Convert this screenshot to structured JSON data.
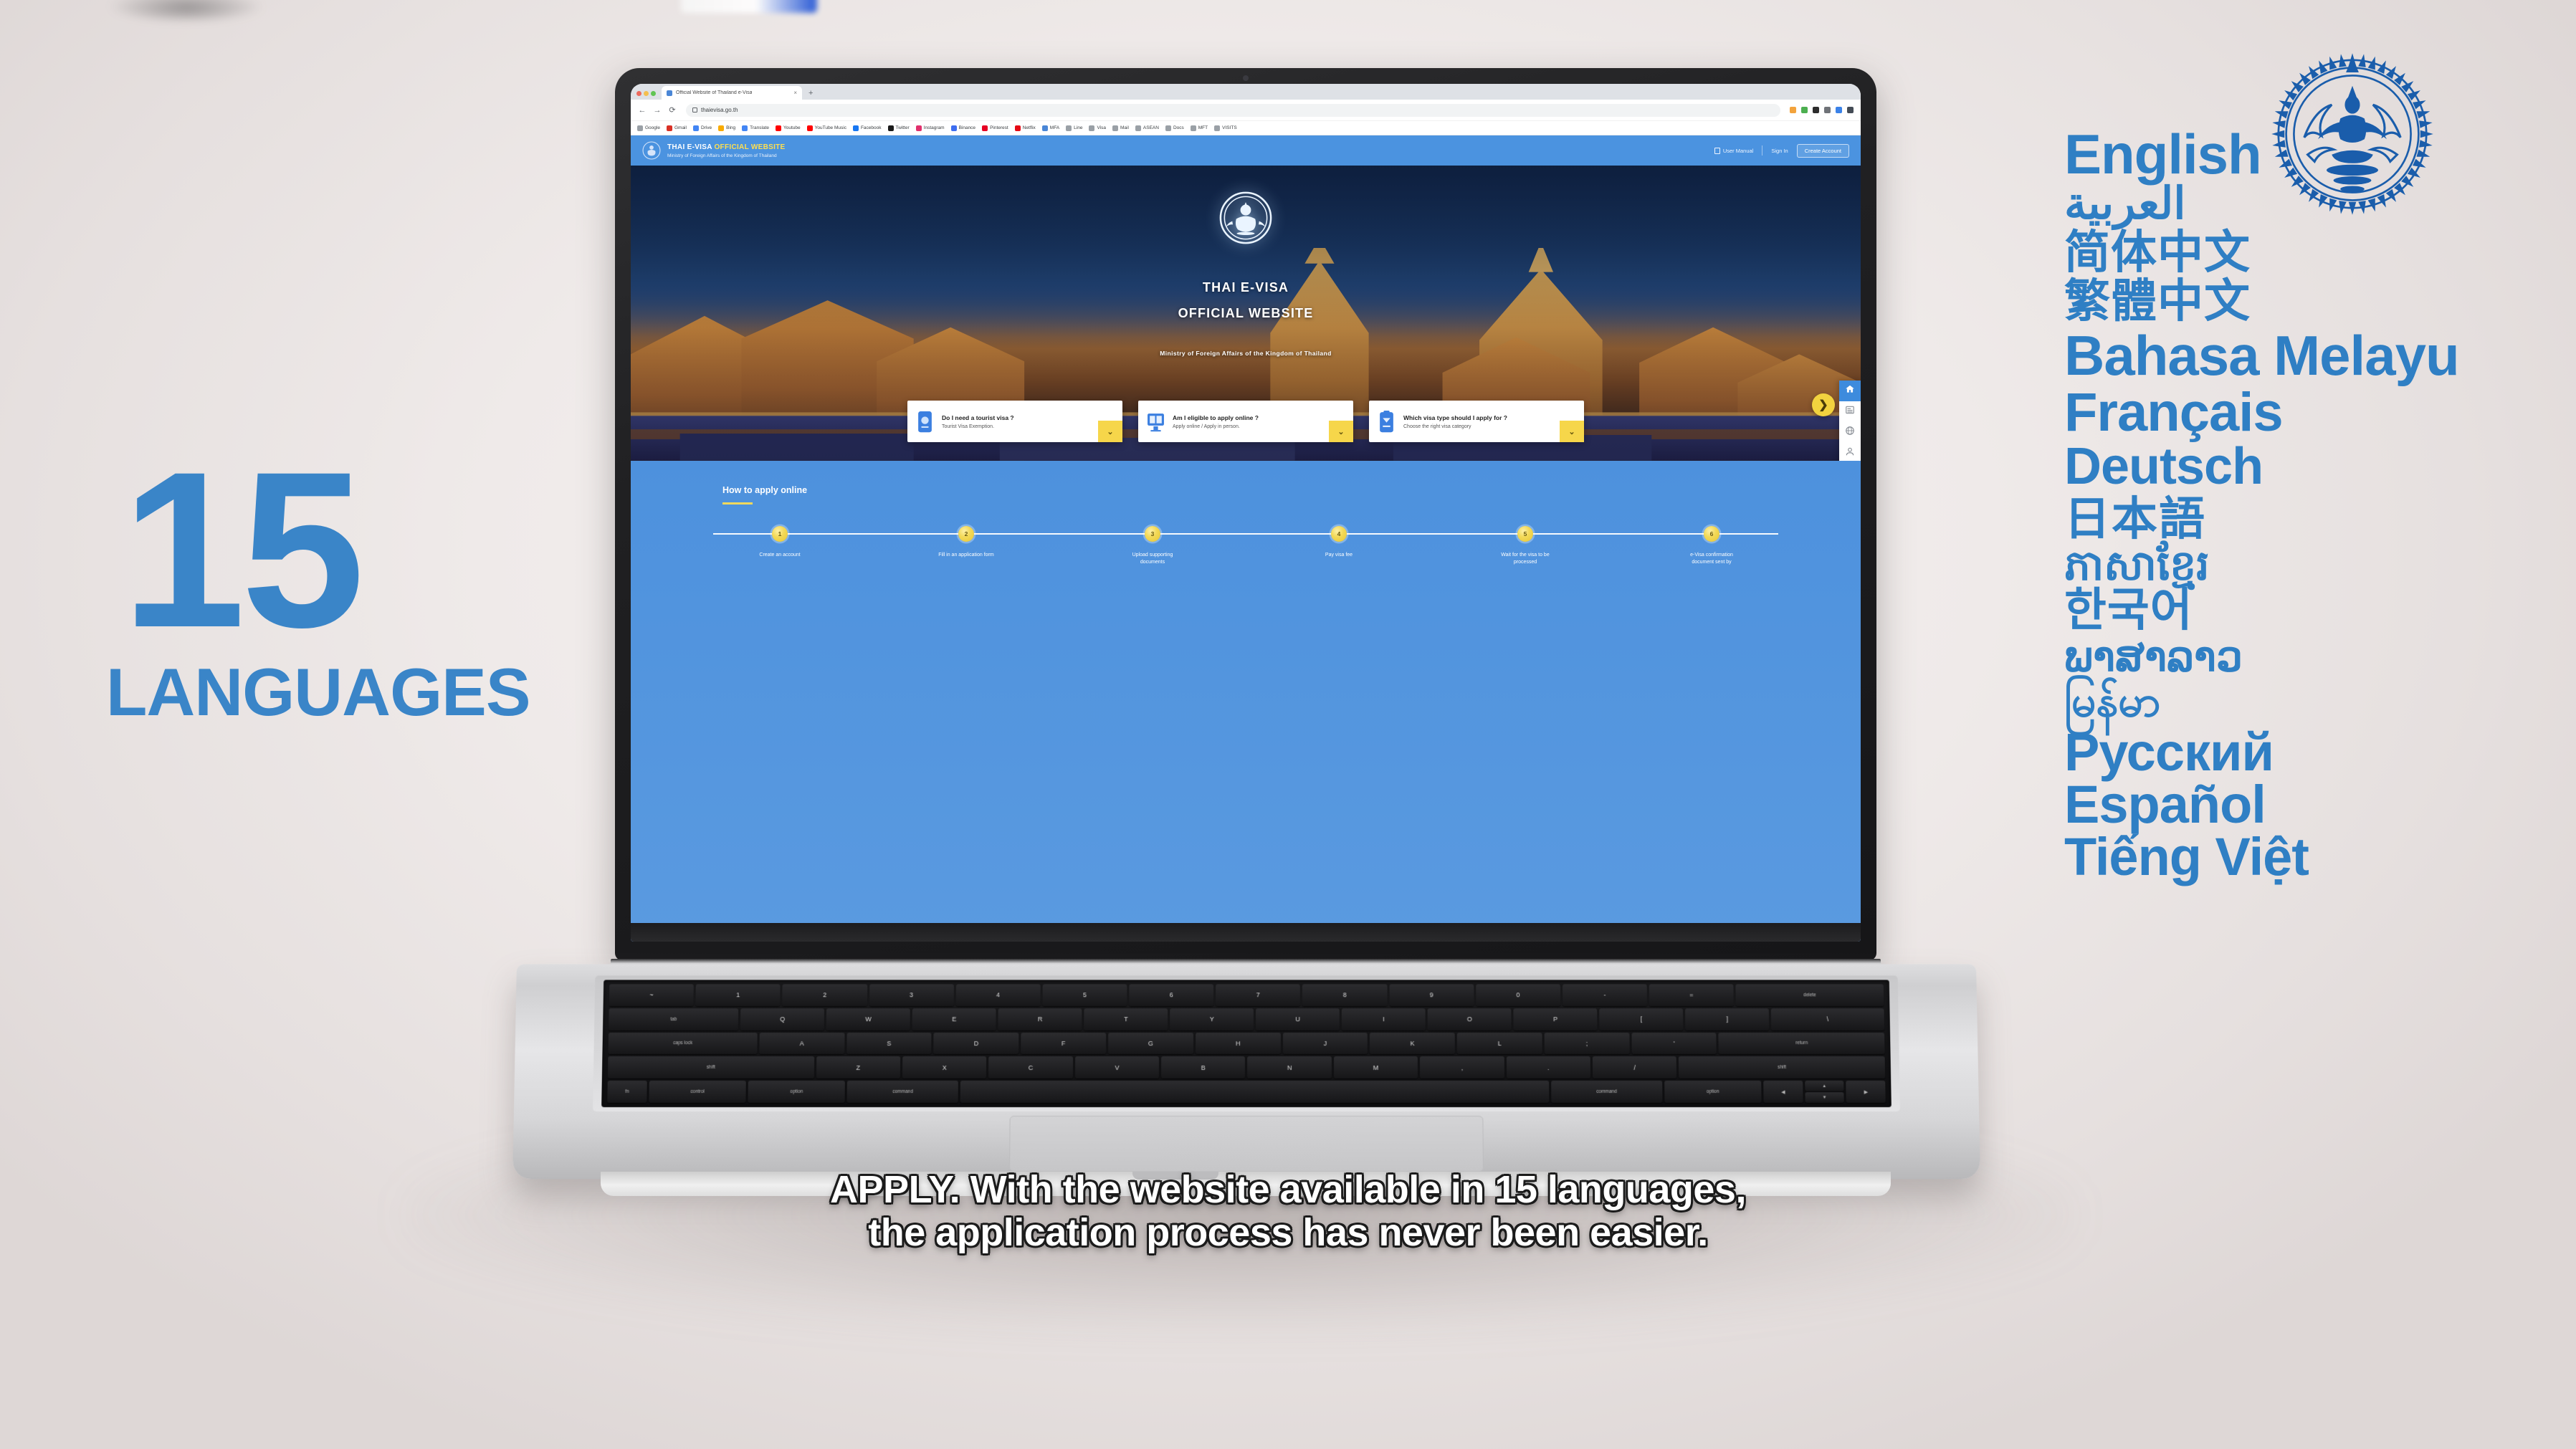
{
  "stat": {
    "number": "15",
    "label": "LANGUAGES"
  },
  "languages": [
    {
      "name": "English",
      "class": "l-en"
    },
    {
      "name": "العربية",
      "class": "l-ar"
    },
    {
      "name": "简体中文",
      "class": "l-cn"
    },
    {
      "name": "繁體中文",
      "class": "l-tw"
    },
    {
      "name": "Bahasa Melayu",
      "class": "l-ms"
    },
    {
      "name": "Français",
      "class": "l-fr"
    },
    {
      "name": "Deutsch",
      "class": "l-de"
    },
    {
      "name": "日本語",
      "class": "l-ja"
    },
    {
      "name": "ភាសាខ្មែរ",
      "class": "l-km"
    },
    {
      "name": "한국어",
      "class": "l-ko"
    },
    {
      "name": "ພາສາລາວ",
      "class": "l-lo"
    },
    {
      "name": "မြန်မာ",
      "class": "l-my"
    },
    {
      "name": "Русский",
      "class": "l-ru"
    },
    {
      "name": "Español",
      "class": "l-es"
    },
    {
      "name": "Tiếng Việt",
      "class": "l-vi"
    }
  ],
  "browser": {
    "tab_title": "Official Website of Thailand e-Visa",
    "tab_close": "×",
    "new_tab": "+",
    "back_icon": "←",
    "forward_icon": "→",
    "reload_icon": "⟳",
    "url": "thaievisa.go.th",
    "bookmarks": [
      {
        "label": "Google",
        "color": "#9aa0a6"
      },
      {
        "label": "Gmail",
        "color": "#d93025"
      },
      {
        "label": "Drive",
        "color": "#4285f4"
      },
      {
        "label": "Bing",
        "color": "#f9ab00"
      },
      {
        "label": "Translate",
        "color": "#4285f4"
      },
      {
        "label": "Youtube",
        "color": "#ff0000"
      },
      {
        "label": "YouTube Music",
        "color": "#ff0000"
      },
      {
        "label": "Facebook",
        "color": "#1877f2"
      },
      {
        "label": "Twitter",
        "color": "#1a1a1a"
      },
      {
        "label": "Instagram",
        "color": "#e1306c"
      },
      {
        "label": "Binance",
        "color": "#3d6df0"
      },
      {
        "label": "Pinterest",
        "color": "#e60023"
      },
      {
        "label": "Netflix",
        "color": "#e50914"
      },
      {
        "label": "MFA",
        "color": "#4a86d6"
      },
      {
        "label": "Line",
        "color": "#9aa0a6"
      },
      {
        "label": "Visa",
        "color": "#9aa0a6"
      },
      {
        "label": "Mail",
        "color": "#9aa0a6"
      },
      {
        "label": "ASEAN",
        "color": "#9aa0a6"
      },
      {
        "label": "Docs",
        "color": "#9aa0a6"
      },
      {
        "label": "MFT",
        "color": "#9aa0a6"
      },
      {
        "label": "VISITS",
        "color": "#9aa0a6"
      }
    ],
    "extensions": [
      "#f3a33c",
      "#4caf50",
      "#2d2d2d",
      "#6f7378",
      "#3b82e8",
      "#444c56"
    ]
  },
  "site": {
    "header": {
      "title_main": "THAI E-VISA ",
      "title_accent": "OFFICIAL WEBSITE",
      "subtitle": "Ministry of Foreign Affairs of the Kingdom of Thailand",
      "user_manual": "User Manual",
      "sign_in": "Sign In",
      "create_account": "Create Account"
    },
    "hero": {
      "line1": "THAI E-VISA",
      "line2": "OFFICIAL WEBSITE",
      "line3": "Ministry of Foreign Affairs of the Kingdom of Thailand"
    },
    "cards": [
      {
        "title": "Do I need a tourist visa ?",
        "sub": "Tourist Visa Exemption.",
        "chevron": "⌄",
        "icon": "passport-icon"
      },
      {
        "title": "Am I eligible to apply online ?",
        "sub": "Apply online / Apply in person.",
        "chevron": "⌄",
        "icon": "monitor-icon"
      },
      {
        "title": "Which visa type should I apply for ?",
        "sub": "Choose the right visa category",
        "chevron": "⌄",
        "icon": "document-icon"
      }
    ],
    "rail": [
      {
        "icon": "home-icon",
        "active": true
      },
      {
        "icon": "news-icon",
        "active": false
      },
      {
        "icon": "globe-icon",
        "active": false
      },
      {
        "icon": "contact-icon",
        "active": false
      }
    ],
    "next_arrow": "❯",
    "howto": {
      "title": "How to apply online",
      "steps": [
        {
          "num": "1",
          "label": "Create an account"
        },
        {
          "num": "2",
          "label": "Fill in an application form"
        },
        {
          "num": "3",
          "label": "Upload supporting documents"
        },
        {
          "num": "4",
          "label": "Pay visa fee"
        },
        {
          "num": "5",
          "label": "Wait for the visa to be processed"
        },
        {
          "num": "6",
          "label": "e-Visa confirmation document sent by"
        }
      ]
    }
  },
  "keyboard": {
    "row1": [
      "~",
      "1",
      "2",
      "3",
      "4",
      "5",
      "6",
      "7",
      "8",
      "9",
      "0",
      "-",
      "=",
      "delete"
    ],
    "row2": [
      "tab",
      "Q",
      "W",
      "E",
      "R",
      "T",
      "Y",
      "U",
      "I",
      "O",
      "P",
      "[",
      "]",
      "\\"
    ],
    "row3": [
      "caps lock",
      "A",
      "S",
      "D",
      "F",
      "G",
      "H",
      "J",
      "K",
      "L",
      ";",
      "'",
      "return"
    ],
    "row4": [
      "shift",
      "Z",
      "X",
      "C",
      "V",
      "B",
      "N",
      "M",
      ",",
      ".",
      "/",
      "shift"
    ],
    "row5": [
      "fn",
      "control",
      "option",
      "command",
      "",
      "command",
      "option"
    ],
    "arrow_left": "◀",
    "arrow_up": "▲",
    "arrow_down": "▼",
    "arrow_right": "▶"
  },
  "caption": {
    "line1": "APPLY. With the website available in 15 languages,",
    "line2": "the application process has never been easier."
  },
  "colors": {
    "brand_blue": "#3a85c8",
    "site_blue": "#4b93e0",
    "accent_yellow": "#f2d33f",
    "emblem_blue": "#1a5dab"
  }
}
